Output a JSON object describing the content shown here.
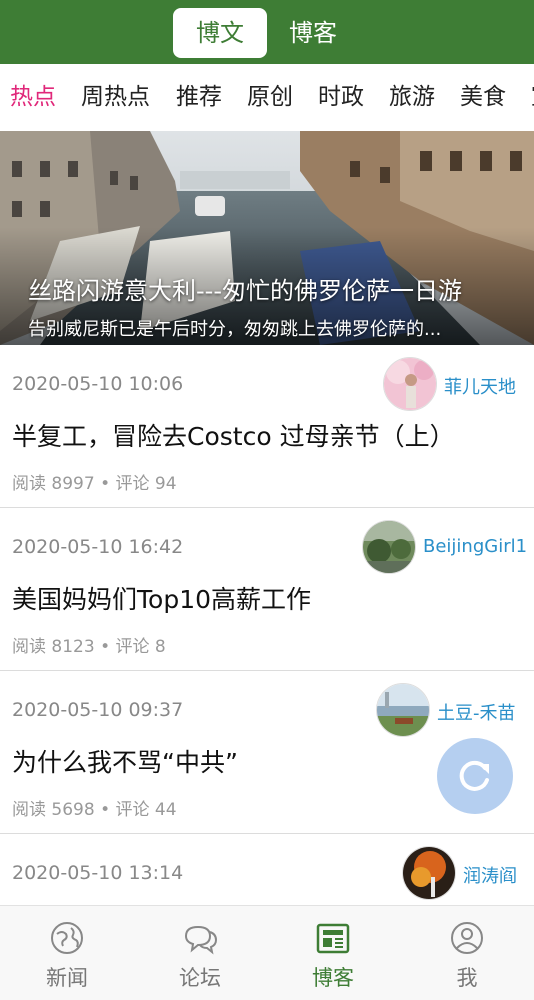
{
  "header": {
    "tabs": [
      {
        "label": "博文",
        "active": true
      },
      {
        "label": "博客",
        "active": false
      }
    ]
  },
  "categories": [
    "热点",
    "周热点",
    "推荐",
    "原创",
    "时政",
    "旅游",
    "美食",
    "室"
  ],
  "active_category": "热点",
  "banner": {
    "title": "丝路闪游意大利---匆忙的佛罗伦萨一日游",
    "subtitle": "告别威尼斯已是午后时分，匆匆跳上去佛罗伦萨的..."
  },
  "posts": [
    {
      "date": "2020-05-10 10:06",
      "author": "菲儿天地",
      "title": "半复工，冒险去Costco 过母亲节（上）",
      "stats": "阅读 8997 • 评论 94"
    },
    {
      "date": "2020-05-10 16:42",
      "author": "BeijingGirl1",
      "title": "美国妈妈们Top10高薪工作",
      "stats": "阅读 8123 • 评论 8"
    },
    {
      "date": "2020-05-10 09:37",
      "author": "土豆-禾苗",
      "title": "为什么我不骂“中共”",
      "stats": "阅读 5698 • 评论 44"
    },
    {
      "date": "2020-05-10 13:14",
      "author": "润涛阎",
      "title": "",
      "stats": ""
    }
  ],
  "bottom_nav": [
    {
      "label": "新闻",
      "icon": "globe-icon",
      "active": false
    },
    {
      "label": "论坛",
      "icon": "chat-icon",
      "active": false
    },
    {
      "label": "博客",
      "icon": "newspaper-icon",
      "active": true
    },
    {
      "label": "我",
      "icon": "user-icon",
      "active": false
    }
  ],
  "colors": {
    "brand_green": "#3e7d35",
    "active_category": "#e0287a",
    "author_link": "#2a8fc9",
    "fab": "#b5cff0"
  }
}
